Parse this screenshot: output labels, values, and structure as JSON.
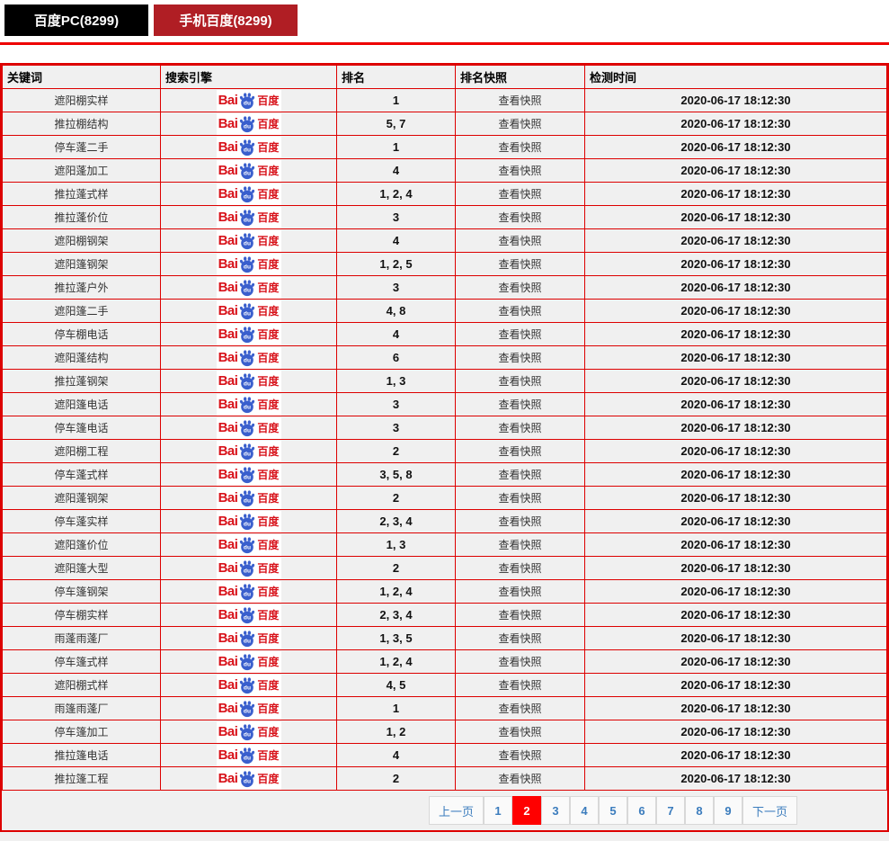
{
  "tabs": [
    {
      "label": "百度PC(8299)",
      "active": false
    },
    {
      "label": "手机百度(8299)",
      "active": true
    }
  ],
  "table": {
    "headers": {
      "keyword": "关键词",
      "engine": "搜索引擎",
      "rank": "排名",
      "snapshot": "排名快照",
      "time": "检测时间"
    },
    "engine": {
      "name": "baidu",
      "text_bai": "Bai",
      "text_du": "du",
      "text_cn": "百度"
    },
    "snapshot_label": "查看快照",
    "check_time": "2020-06-17 18:12:30",
    "rows": [
      {
        "keyword": "遮阳棚实样",
        "rank": "1"
      },
      {
        "keyword": "推拉棚结构",
        "rank": "5, 7"
      },
      {
        "keyword": "停车蓬二手",
        "rank": "1"
      },
      {
        "keyword": "遮阳蓬加工",
        "rank": "4"
      },
      {
        "keyword": "推拉蓬式样",
        "rank": "1, 2, 4"
      },
      {
        "keyword": "推拉蓬价位",
        "rank": "3"
      },
      {
        "keyword": "遮阳棚钢架",
        "rank": "4"
      },
      {
        "keyword": "遮阳篷钢架",
        "rank": "1, 2, 5"
      },
      {
        "keyword": "推拉蓬户外",
        "rank": "3"
      },
      {
        "keyword": "遮阳篷二手",
        "rank": "4, 8"
      },
      {
        "keyword": "停车棚电话",
        "rank": "4"
      },
      {
        "keyword": "遮阳蓬结构",
        "rank": "6"
      },
      {
        "keyword": "推拉蓬钢架",
        "rank": "1, 3"
      },
      {
        "keyword": "遮阳篷电话",
        "rank": "3"
      },
      {
        "keyword": "停车篷电话",
        "rank": "3"
      },
      {
        "keyword": "遮阳棚工程",
        "rank": "2"
      },
      {
        "keyword": "停车蓬式样",
        "rank": "3, 5, 8"
      },
      {
        "keyword": "遮阳蓬钢架",
        "rank": "2"
      },
      {
        "keyword": "停车蓬实样",
        "rank": "2, 3, 4"
      },
      {
        "keyword": "遮阳篷价位",
        "rank": "1, 3"
      },
      {
        "keyword": "遮阳篷大型",
        "rank": "2"
      },
      {
        "keyword": "停车篷钢架",
        "rank": "1, 2, 4"
      },
      {
        "keyword": "停车棚实样",
        "rank": "2, 3, 4"
      },
      {
        "keyword": "雨蓬雨蓬厂",
        "rank": "1, 3, 5"
      },
      {
        "keyword": "停车篷式样",
        "rank": "1, 2, 4"
      },
      {
        "keyword": "遮阳棚式样",
        "rank": "4, 5"
      },
      {
        "keyword": "雨篷雨蓬厂",
        "rank": "1"
      },
      {
        "keyword": "停车篷加工",
        "rank": "1, 2"
      },
      {
        "keyword": "推拉篷电话",
        "rank": "4"
      },
      {
        "keyword": "推拉篷工程",
        "rank": "2"
      }
    ]
  },
  "pagination": {
    "prev": "上一页",
    "next": "下一页",
    "pages": [
      "1",
      "2",
      "3",
      "4",
      "5",
      "6",
      "7",
      "8",
      "9"
    ],
    "active": "2"
  },
  "colors": {
    "border_red": "#dd0000",
    "line_red": "#ee0000",
    "tab_pc_bg": "#000000",
    "tab_mobile_bg": "#b01e24",
    "active_page_bg": "#ff0000",
    "pager_link_blue": "#3b7cbd",
    "baidu_red": "#d8121a",
    "baidu_blue": "#3a5fcd",
    "cell_bg": "#f0f0f0"
  }
}
